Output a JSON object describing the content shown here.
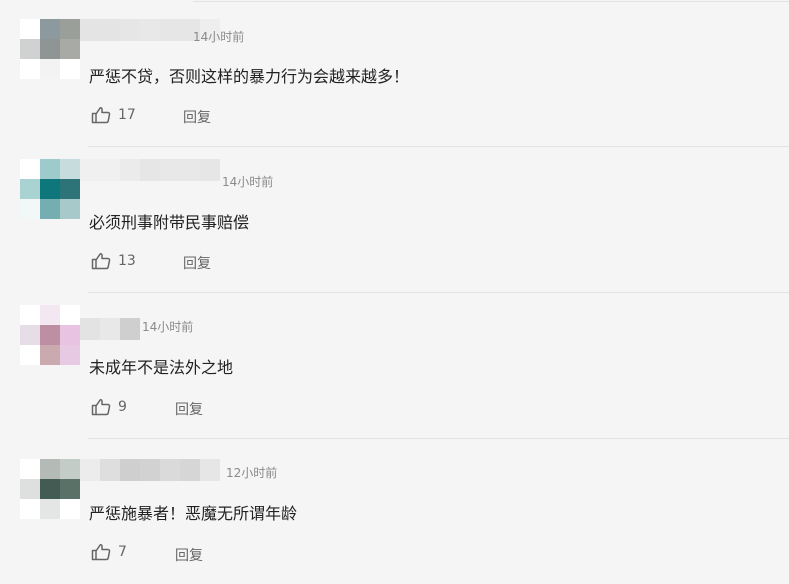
{
  "comments": [
    {
      "time": "14小时前",
      "text": "严惩不贷，否则这样的暴力行为会越来越多！",
      "likes": "17",
      "reply_label": "回复",
      "avatar_colors": [
        "#ffffff",
        "#8c9aa0",
        "#9a9f9a",
        "#cfd2d0",
        "#8f9595",
        "#a8aba5",
        "#ffffff",
        "#f3f3f3",
        "#ffffff"
      ],
      "name_colors": [
        "#e4e4e4",
        "#e4e4e4",
        "#e6e6e6",
        "#e8e8e8",
        "#e6e6e6",
        "#e6e6e6",
        "#eeeeee"
      ]
    },
    {
      "time": "14小时前",
      "text": "必须刑事附带民事赔偿",
      "likes": "13",
      "reply_label": "回复",
      "avatar_colors": [
        "#ffffff",
        "#9dcacb",
        "#c7dddd",
        "#a9d3d3",
        "#0e777c",
        "#2d7479",
        "#f2f8f8",
        "#74aeb1",
        "#a8c9ca"
      ],
      "name_colors": [
        "#f0f0f0",
        "#f0f0f0",
        "#ebebeb",
        "#e6e6e6",
        "#e8e8e8",
        "#e8e8e8",
        "#e6e6e6"
      ]
    },
    {
      "time": "14小时前",
      "text": "未成年不是法外之地",
      "likes": "9",
      "reply_label": "回复",
      "avatar_colors": [
        "#ffffff",
        "#f3e8f2",
        "#ffffff",
        "#e6dde6",
        "#be8ea3",
        "#e9c4e2",
        "#ffffff",
        "#caaaae",
        "#e8c9e3"
      ],
      "name_colors": [
        "#e3e3e3",
        "#e8e8e8",
        "#cfcfcf"
      ]
    },
    {
      "time": "12小时前",
      "text": "严惩施暴者！恶魔无所谓年龄",
      "likes": "7",
      "reply_label": "回复",
      "avatar_colors": [
        "#ffffff",
        "#b4bbb6",
        "#c4ccc8",
        "#dde0de",
        "#435c53",
        "#5a7167",
        "#ffffff",
        "#e3e6e4",
        "#ffffff"
      ],
      "name_colors": [
        "#ececec",
        "#dedede",
        "#cfcfcf",
        "#d2d2d2",
        "#dadada",
        "#d6d6d6",
        "#e6e6e6"
      ]
    }
  ]
}
